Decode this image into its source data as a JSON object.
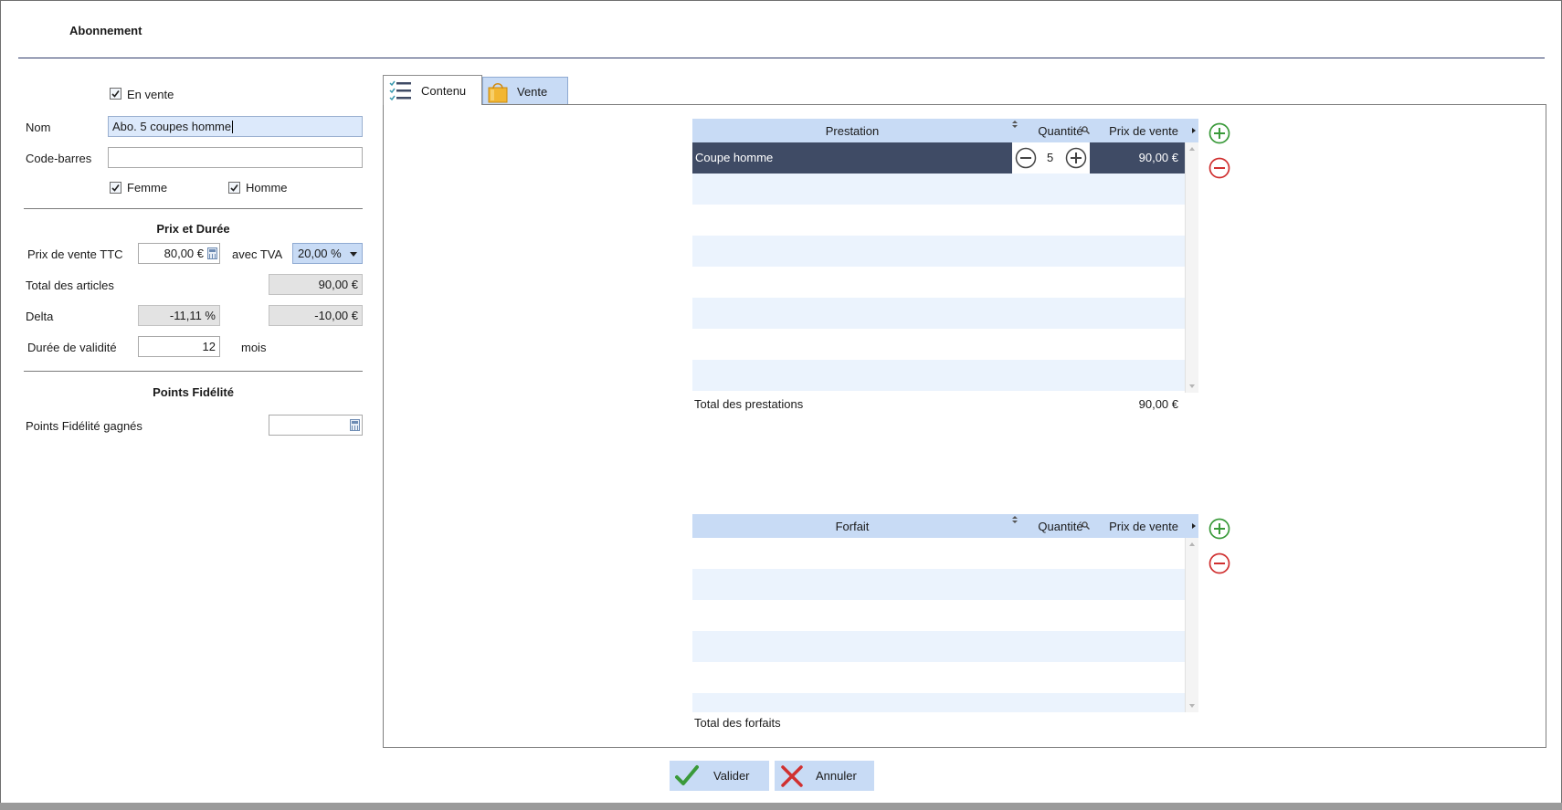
{
  "header": {
    "title": "Abonnement"
  },
  "form": {
    "en_vente": {
      "label": "En vente",
      "checked": true
    },
    "nom": {
      "label": "Nom",
      "value": "Abo. 5 coupes homme"
    },
    "code_barres": {
      "label": "Code-barres",
      "value": ""
    },
    "femme": {
      "label": "Femme",
      "checked": true
    },
    "homme": {
      "label": "Homme",
      "checked": true
    },
    "prix_duree": {
      "title": "Prix et Durée",
      "prix_vente_label": "Prix de vente TTC",
      "prix_vente_value": "80,00 €",
      "tva_label": "avec TVA",
      "tva_value": "20,00 %",
      "total_articles_label": "Total des articles",
      "total_articles_value": "90,00 €",
      "delta_label": "Delta",
      "delta_percent": "-11,11 %",
      "delta_amount": "-10,00 €",
      "duree_label": "Durée de validité",
      "duree_value": "12",
      "duree_unit": "mois"
    },
    "points": {
      "title": "Points Fidélité",
      "gagnes_label": "Points Fidélité gagnés",
      "gagnes_value": ""
    }
  },
  "tabs": [
    {
      "label": "Contenu",
      "active": true,
      "icon": "list-check-icon"
    },
    {
      "label": "Vente",
      "active": false,
      "icon": "shopping-bag-icon"
    }
  ],
  "prestations_grid": {
    "columns": [
      "Prestation",
      "Quantité",
      "Prix de vente"
    ],
    "rows": [
      {
        "name": "Coupe homme",
        "quantity": "5",
        "price": "90,00 €",
        "selected": true
      }
    ],
    "total_label": "Total des prestations",
    "total_value": "90,00 €"
  },
  "forfaits_grid": {
    "columns": [
      "Forfait",
      "Quantité",
      "Prix de vente"
    ],
    "rows": [],
    "total_label": "Total des forfaits",
    "total_value": ""
  },
  "actions": {
    "valider": "Valider",
    "annuler": "Annuler"
  },
  "colors": {
    "accent_light": "#c8dbf5",
    "row_alt": "#ebf3fd",
    "row_selected": "#3f4b65",
    "add_green": "#3a9a3a",
    "remove_red": "#d03030"
  }
}
